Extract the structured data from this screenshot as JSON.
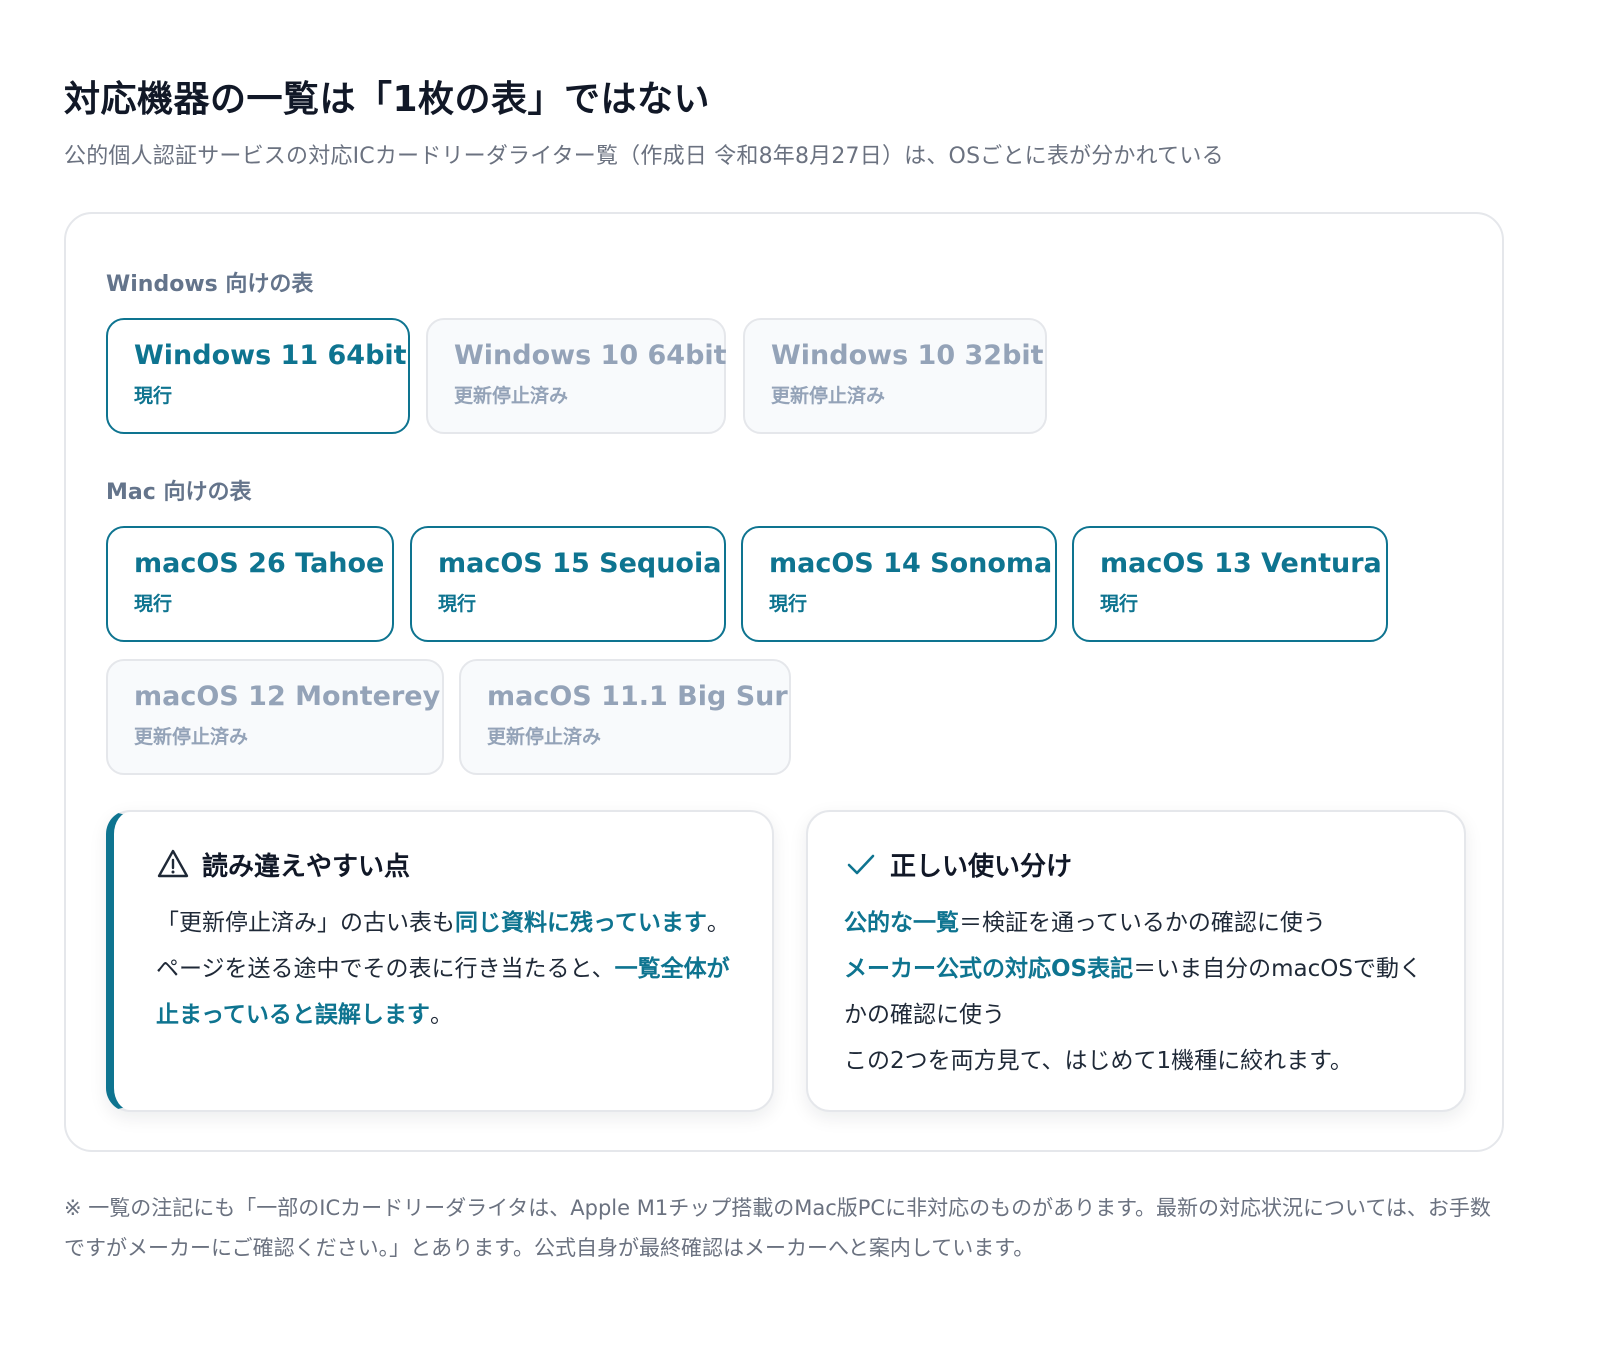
{
  "header": {
    "title": "対応機器の一覧は「1枚の表」ではない",
    "subtitle": "公的個人認証サービスの対応ICカードリーダライター覧（作成日 令和8年8月27日）は、OSごとに表が分かれている"
  },
  "windows": {
    "label": "Windows 向けの表",
    "items": [
      {
        "name": "Windows 11 64bit",
        "status": "現行"
      },
      {
        "name": "Windows 10 64bit",
        "status": "更新停止済み"
      },
      {
        "name": "Windows 10 32bit",
        "status": "更新停止済み"
      }
    ]
  },
  "mac": {
    "label": "Mac 向けの表",
    "items": [
      {
        "name": "macOS 26 Tahoe",
        "status": "現行"
      },
      {
        "name": "macOS 15 Sequoia",
        "status": "現行"
      },
      {
        "name": "macOS 14 Sonoma",
        "status": "現行"
      },
      {
        "name": "macOS 13 Ventura",
        "status": "現行"
      },
      {
        "name": "macOS 12 Monterey",
        "status": "更新停止済み"
      },
      {
        "name": "macOS 11.1 Big Sur",
        "status": "更新停止済み"
      }
    ]
  },
  "warning": {
    "icon": "warning-icon",
    "title": "読み違えやすい点",
    "p1": "「更新停止済み」の古い表も",
    "h1": "同じ資料に残っています",
    "p2": "。ページを送る途中でその表に行き当たると、",
    "h2": "一覧全体が止まっていると誤解します",
    "p3": "。"
  },
  "usage": {
    "icon": "check-icon",
    "title": "正しい使い分け",
    "line1_hl": "公的な一覧",
    "line1_rest": "＝検証を通っているかの確認に使う",
    "line2_hl": "メーカー公式の対応OS表記",
    "line2_rest": "＝いま自分のmacOSで動くかの確認に使う",
    "line3": "この2つを両方見て、はじめて1機種に絞れます。"
  },
  "footnote": "※ 一覧の注記にも「一部のICカードリーダライタは、Apple M1チップ搭載のMac版PCに非対応のものがあります。最新の対応状況については、お手数ですがメーカーにご確認ください。」とあります。公式自身が最終確認はメーカーへと案内しています。",
  "colors": {
    "accent": "#0e7490",
    "muted": "#94a3b8"
  }
}
